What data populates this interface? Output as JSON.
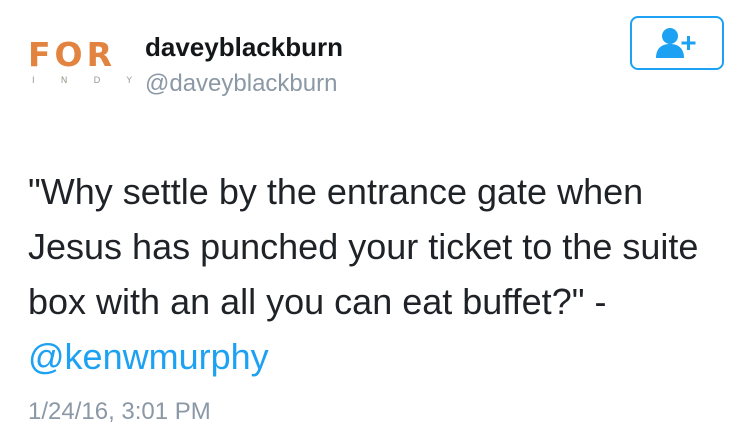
{
  "account": {
    "logo_main": "FOR",
    "logo_sub": [
      "I",
      "N",
      "D",
      "Y"
    ],
    "display_name": "daveyblackburn",
    "handle": "@daveyblackburn"
  },
  "follow_button": {
    "icon": "follow-add-user-icon",
    "accent_color": "#1da1f2"
  },
  "tweet": {
    "text_before_mention": "\"Why settle by the entrance gate when Jesus has punched your ticket to the suite box with an all you can eat buffet?\" -",
    "mention": "@kenwmurphy",
    "timestamp": "1/24/16, 3:01 PM"
  },
  "colors": {
    "logo_orange": "#e2833f",
    "text": "#1f2328",
    "muted": "#8b98a5",
    "link": "#1da1f2"
  }
}
